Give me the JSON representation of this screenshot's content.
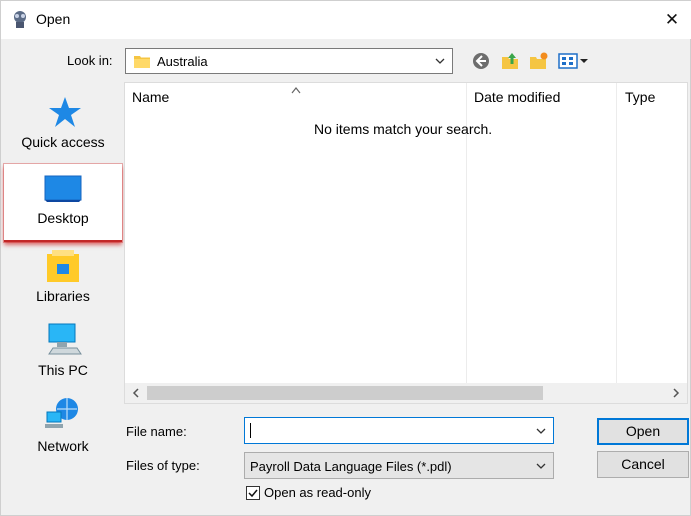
{
  "window": {
    "title": "Open",
    "close_glyph": "✕"
  },
  "lookin": {
    "label": "Look in:",
    "value": "Australia"
  },
  "places": [
    {
      "label": "Quick access",
      "icon": "star-icon"
    },
    {
      "label": "Desktop",
      "icon": "desktop-icon",
      "selected": true
    },
    {
      "label": "Libraries",
      "icon": "libraries-icon"
    },
    {
      "label": "This PC",
      "icon": "computer-icon"
    },
    {
      "label": "Network",
      "icon": "network-icon"
    }
  ],
  "list": {
    "columns": [
      "Name",
      "Date modified",
      "Type"
    ],
    "empty_message": "No items match your search."
  },
  "filename": {
    "label": "File name:",
    "value": ""
  },
  "filetype": {
    "label": "Files of type:",
    "value": "Payroll Data Language Files (*.pdl)"
  },
  "readonly": {
    "label": "Open as read-only",
    "checked": true
  },
  "buttons": {
    "open": "Open",
    "cancel": "Cancel"
  },
  "colors": {
    "accent": "#0078d7",
    "selection_glow": "#c32727",
    "desktop_blue": "#1e88e5"
  }
}
